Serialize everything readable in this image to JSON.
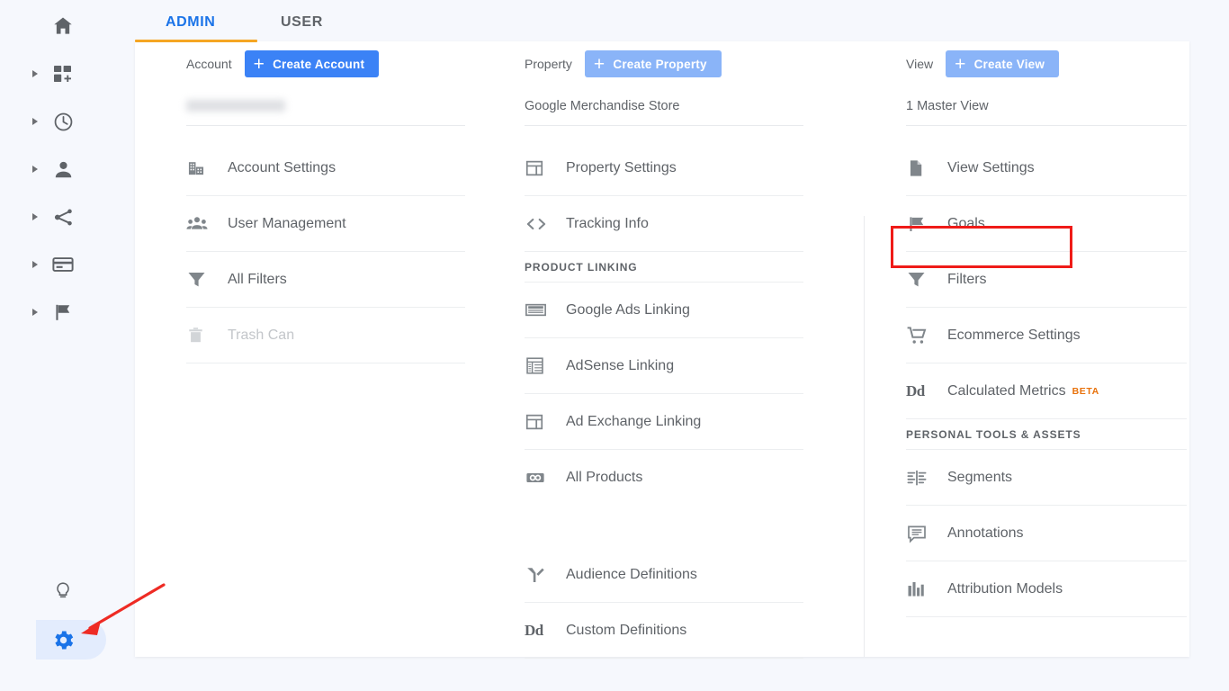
{
  "app": {
    "title": "Google Analytics Admin"
  },
  "tabs": [
    {
      "id": "admin",
      "label": "ADMIN",
      "active": true
    },
    {
      "id": "user",
      "label": "USER",
      "active": false
    }
  ],
  "colors": {
    "tab_active": "#1a73e8",
    "tab_underline": "#f5a623",
    "create_button_primary": "#3b82f6",
    "create_button_muted": "#8ab4f8",
    "highlight_box": "#ef1b18",
    "arrow": "#ee2b24",
    "beta_badge": "#e8710a",
    "rail_active_icon": "#1a73e8",
    "rail_active_bg": "#e3ecfd",
    "page_background": "#f6f8fd",
    "panel_background": "#ffffff"
  },
  "sidebar": {
    "items": [
      {
        "id": "home",
        "icon": "home-icon",
        "caret": false,
        "active": false
      },
      {
        "id": "customization",
        "icon": "dashboard-plus-icon",
        "caret": true,
        "active": false
      },
      {
        "id": "realtime",
        "icon": "clock-icon",
        "caret": true,
        "active": false
      },
      {
        "id": "audience",
        "icon": "person-icon",
        "caret": true,
        "active": false
      },
      {
        "id": "acquisition",
        "icon": "share-nodes-icon",
        "caret": true,
        "active": false
      },
      {
        "id": "behavior",
        "icon": "card-icon",
        "caret": true,
        "active": false
      },
      {
        "id": "conversions",
        "icon": "flag-icon",
        "caret": true,
        "active": false
      }
    ],
    "bottom_items": [
      {
        "id": "discover",
        "icon": "lightbulb-icon",
        "active": false
      },
      {
        "id": "admin",
        "icon": "gear-icon",
        "active": true
      }
    ]
  },
  "columns": {
    "account": {
      "header_label": "Account",
      "create_button": "Create Account",
      "create_button_style": "strong",
      "plus_glyph": "+",
      "selected": "",
      "selected_redacted": true,
      "items": [
        {
          "label": "Account Settings",
          "icon": "building-icon",
          "disabled": false
        },
        {
          "label": "User Management",
          "icon": "people-icon",
          "disabled": false
        },
        {
          "label": "All Filters",
          "icon": "funnel-icon",
          "disabled": false
        },
        {
          "label": "Trash Can",
          "icon": "trash-icon",
          "disabled": true
        }
      ]
    },
    "property": {
      "header_label": "Property",
      "create_button": "Create Property",
      "create_button_style": "muted",
      "plus_glyph": "+",
      "selected": "Google Merchandise Store",
      "selected_redacted": false,
      "items": [
        {
          "label": "Property Settings",
          "icon": "layout-icon",
          "disabled": false
        },
        {
          "label": "Tracking Info",
          "icon": "code-brackets-icon",
          "disabled": false
        },
        {
          "label": "PRODUCT LINKING",
          "type": "section",
          "disabled": false
        },
        {
          "label": "Google Ads Linking",
          "icon": "ads-banner-icon",
          "disabled": false
        },
        {
          "label": "AdSense Linking",
          "icon": "adsense-icon",
          "disabled": false
        },
        {
          "label": "Ad Exchange Linking",
          "icon": "layout-icon",
          "disabled": false
        },
        {
          "label": "All Products",
          "icon": "link-chain-icon",
          "disabled": false
        },
        {
          "label": "",
          "type": "gap"
        },
        {
          "label": "Audience Definitions",
          "icon": "audience-branch-icon",
          "disabled": false
        },
        {
          "label": "Custom Definitions",
          "icon": "dd-icon",
          "disabled": false
        }
      ]
    },
    "view": {
      "header_label": "View",
      "create_button": "Create View",
      "create_button_style": "muted",
      "plus_glyph": "+",
      "selected": "1 Master View",
      "selected_redacted": false,
      "items": [
        {
          "label": "View Settings",
          "icon": "document-icon",
          "disabled": false
        },
        {
          "label": "Goals",
          "icon": "flag-icon",
          "disabled": false,
          "highlighted": true
        },
        {
          "label": "Filters",
          "icon": "funnel-icon",
          "disabled": false
        },
        {
          "label": "Ecommerce Settings",
          "icon": "cart-icon",
          "disabled": false
        },
        {
          "label": "Calculated Metrics",
          "icon": "dd-icon",
          "badge": "BETA",
          "disabled": false
        },
        {
          "label": "PERSONAL TOOLS & ASSETS",
          "type": "section",
          "disabled": false
        },
        {
          "label": "Segments",
          "icon": "segments-icon",
          "disabled": false
        },
        {
          "label": "Annotations",
          "icon": "annotation-icon",
          "disabled": false
        },
        {
          "label": "Attribution Models",
          "icon": "bar-chart-icon",
          "disabled": false
        }
      ]
    }
  },
  "annotations": {
    "highlight_target": "Goals",
    "arrow_target": "admin-gear-button"
  }
}
